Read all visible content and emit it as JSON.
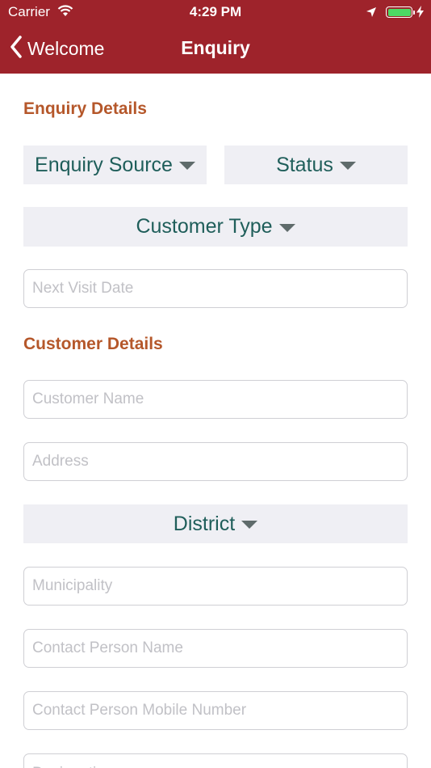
{
  "status_bar": {
    "carrier": "Carrier",
    "time": "4:29 PM"
  },
  "nav": {
    "back_label": "Welcome",
    "title": "Enquiry"
  },
  "sections": {
    "enquiry_details": "Enquiry Details",
    "customer_details": "Customer Details"
  },
  "dropdowns": {
    "enquiry_source": "Enquiry Source",
    "status": "Status",
    "customer_type": "Customer Type",
    "district": "District"
  },
  "fields": {
    "next_visit_date": {
      "placeholder": "Next Visit Date",
      "value": ""
    },
    "customer_name": {
      "placeholder": "Customer Name",
      "value": ""
    },
    "address": {
      "placeholder": "Address",
      "value": ""
    },
    "municipality": {
      "placeholder": "Municipality",
      "value": ""
    },
    "contact_person_name": {
      "placeholder": "Contact Person Name",
      "value": ""
    },
    "contact_person_mobile": {
      "placeholder": "Contact Person Mobile Number",
      "value": ""
    },
    "designation": {
      "placeholder": "Designation",
      "value": ""
    }
  },
  "colors": {
    "nav_background": "#9e232b",
    "section_title": "#b5572a",
    "dropdown_text": "#1f5e5a",
    "dropdown_background": "#efeff4",
    "battery": "#4cd964"
  }
}
